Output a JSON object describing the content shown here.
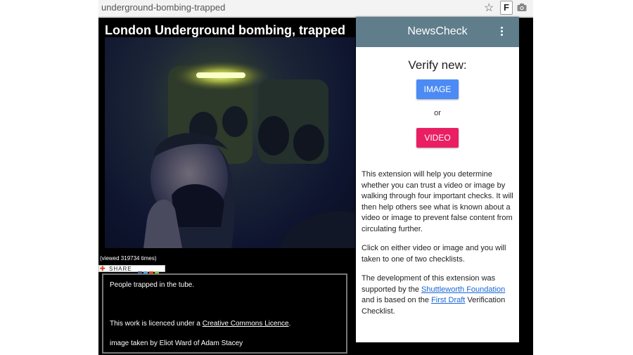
{
  "browser": {
    "url": "underground-bombing-trapped",
    "extension_icon_letter": "F"
  },
  "page": {
    "title": "London Underground bombing, trapped",
    "view_count": "(viewed 319734 times)",
    "share_label": "SHARE",
    "description": {
      "caption": "People trapped in the tube.",
      "licence_prefix": "This work is licenced under a ",
      "licence_link": "Creative Commons Licence",
      "licence_suffix": ".",
      "credit": "image taken by Eliot Ward of Adam Stacey"
    }
  },
  "popup": {
    "title": "NewsCheck",
    "verify_heading": "Verify new:",
    "image_button": "IMAGE",
    "or_text": "or",
    "video_button": "VIDEO",
    "para1": "This extension will help you determine whether you can trust a video or image by walking through four important checks. It will then help others see what is known about a video or image to prevent false content from circulating further.",
    "para2": "Click on either video or image and you will taken to one of two checklists.",
    "para3_prefix": "The development of this extension was supported by the ",
    "para3_link1": "Shuttleworth Foundation",
    "para3_middle": " and is based on the ",
    "para3_link2": "First Draft",
    "para3_suffix": " Verification Checklist."
  },
  "colors": {
    "popup_header": "#607d8b",
    "image_button": "#4c8bf5",
    "video_button": "#e91e63",
    "link": "#1a66d6"
  },
  "icons": [
    "star-icon",
    "camera-icon",
    "more-vert-icon",
    "share-plus-icon"
  ]
}
